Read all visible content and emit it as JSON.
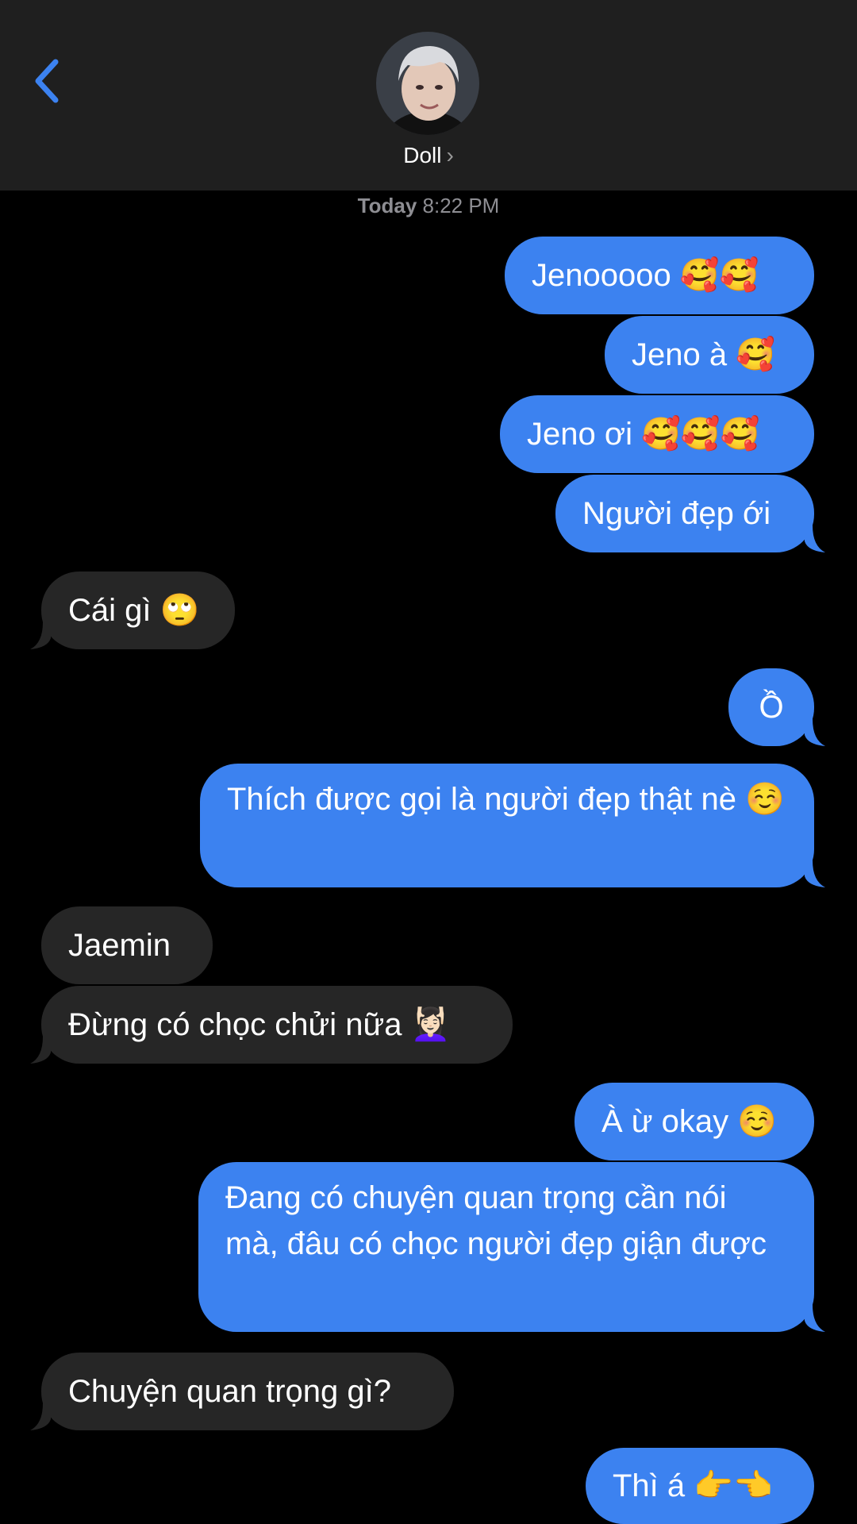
{
  "header": {
    "back_icon": "chevron-left-icon",
    "contact_name": "Doll",
    "contact_chevron": "›"
  },
  "timestamp": {
    "day": "Today",
    "time": "8:22 PM"
  },
  "colors": {
    "outgoing": "#3c82f0",
    "incoming": "#262626",
    "accent": "#3c82f0"
  },
  "messages": [
    {
      "dir": "out",
      "text": "Jenooooo 🥰🥰"
    },
    {
      "dir": "out",
      "text": "Jeno à 🥰"
    },
    {
      "dir": "out",
      "text": "Jeno ơi 🥰🥰🥰"
    },
    {
      "dir": "out",
      "text": "Người đẹp ới"
    },
    {
      "dir": "in",
      "text": "Cái gì 🙄"
    },
    {
      "dir": "out",
      "text": "Ồ"
    },
    {
      "dir": "out",
      "text": "Thích được gọi là người đẹp thật nè ☺️"
    },
    {
      "dir": "in",
      "text": "Jaemin"
    },
    {
      "dir": "in",
      "text": "Đừng có chọc chửi nữa 💆🏻‍♀️"
    },
    {
      "dir": "out",
      "text": "À ừ okay ☺️"
    },
    {
      "dir": "out",
      "text": "Đang có chuyện quan trọng cần nói mà, đâu có chọc người đẹp giận được"
    },
    {
      "dir": "in",
      "text": "Chuyện quan trọng gì?"
    },
    {
      "dir": "out",
      "text": "Thì á 👉👈"
    }
  ]
}
